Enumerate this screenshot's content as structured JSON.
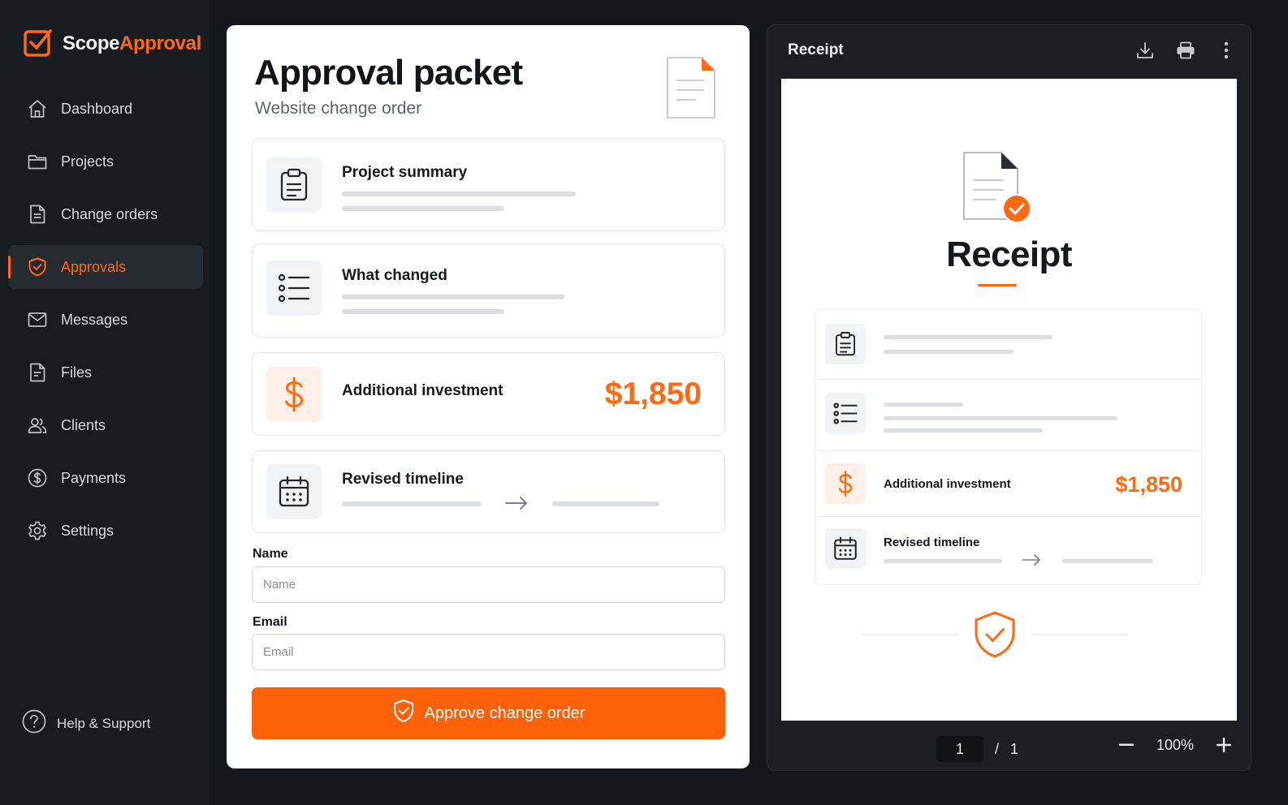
{
  "app": {
    "brand_part1": "Scope",
    "brand_part2": "Approval",
    "accent_color": "#ff6a13"
  },
  "sidebar": {
    "items": [
      {
        "label": "Dashboard",
        "icon": "home-icon",
        "active": false
      },
      {
        "label": "Projects",
        "icon": "folder-icon",
        "active": false
      },
      {
        "label": "Change orders",
        "icon": "document-icon",
        "active": false
      },
      {
        "label": "Approvals",
        "icon": "shield-check-icon",
        "active": true
      },
      {
        "label": "Messages",
        "icon": "mail-icon",
        "active": false
      },
      {
        "label": "Files",
        "icon": "file-icon",
        "active": false
      },
      {
        "label": "Clients",
        "icon": "users-icon",
        "active": false
      },
      {
        "label": "Payments",
        "icon": "dollar-circle-icon",
        "active": false
      },
      {
        "label": "Settings",
        "icon": "gear-icon",
        "active": false
      }
    ],
    "help_label": "Help & Support"
  },
  "packet": {
    "title": "Approval packet",
    "subtitle": "Website change order",
    "sections": {
      "summary": {
        "label": "Project summary",
        "icon": "clipboard-icon"
      },
      "changes": {
        "label": "What changed",
        "icon": "list-icon"
      },
      "investment": {
        "label": "Additional investment",
        "amount": "$1,850",
        "icon": "dollar-icon"
      },
      "timeline": {
        "label": "Revised timeline",
        "icon": "calendar-icon"
      }
    },
    "form": {
      "name_label": "Name",
      "name_placeholder": "Name",
      "email_label": "Email",
      "email_placeholder": "Email"
    },
    "approve_label": "Approve change order"
  },
  "viewer": {
    "title": "Receipt",
    "tools": [
      "download-icon",
      "print-icon",
      "more-vertical-icon"
    ],
    "receipt": {
      "heading": "Receipt",
      "investment_label": "Additional investment",
      "investment_amount": "$1,850",
      "timeline_label": "Revised timeline"
    },
    "pager": {
      "current": "1",
      "separator": "/",
      "total": "1"
    },
    "zoom": "100%"
  }
}
